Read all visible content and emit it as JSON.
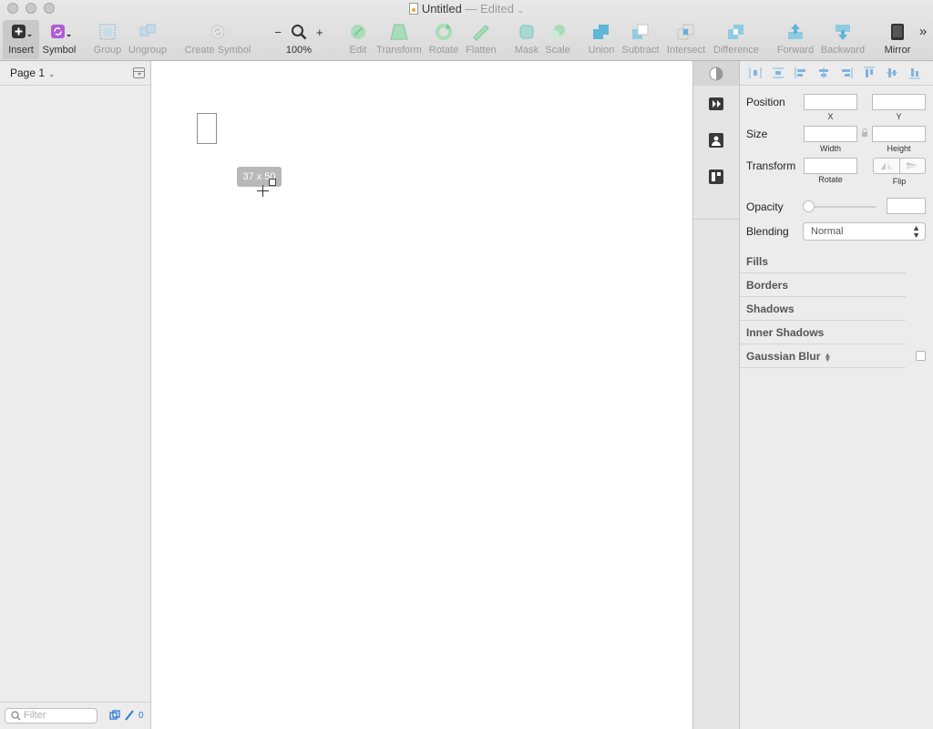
{
  "window": {
    "title": "Untitled",
    "edited_suffix": "— Edited",
    "title_caret": "⌄"
  },
  "toolbar": {
    "insert": "Insert",
    "symbol": "Symbol",
    "group": "Group",
    "ungroup": "Ungroup",
    "create_symbol": "Create Symbol",
    "zoom_minus": "−",
    "zoom_level": "100%",
    "zoom_plus": "+",
    "edit": "Edit",
    "transform": "Transform",
    "rotate": "Rotate",
    "flatten": "Flatten",
    "mask": "Mask",
    "scale": "Scale",
    "union": "Union",
    "subtract": "Subtract",
    "intersect": "Intersect",
    "difference": "Difference",
    "forward": "Forward",
    "backward": "Backward",
    "mirror": "Mirror",
    "overflow": "»"
  },
  "sidebar": {
    "page": "Page 1",
    "filter_placeholder": "Filter",
    "count": "0"
  },
  "canvas": {
    "size_tooltip": "37 x 50"
  },
  "inspector": {
    "position": "Position",
    "x": "X",
    "y": "Y",
    "size": "Size",
    "width": "Width",
    "height": "Height",
    "transform": "Transform",
    "rotate": "Rotate",
    "flip": "Flip",
    "opacity": "Opacity",
    "blending": "Blending",
    "blending_value": "Normal",
    "fills": "Fills",
    "borders": "Borders",
    "shadows": "Shadows",
    "inner_shadows": "Inner Shadows",
    "gaussian_blur": "Gaussian Blur"
  },
  "colors": {
    "accent": "#2b79d6",
    "symbol_purple": "#b15cd6",
    "tool_teal": "#5fb6d6",
    "tool_green": "#6cc48f"
  }
}
